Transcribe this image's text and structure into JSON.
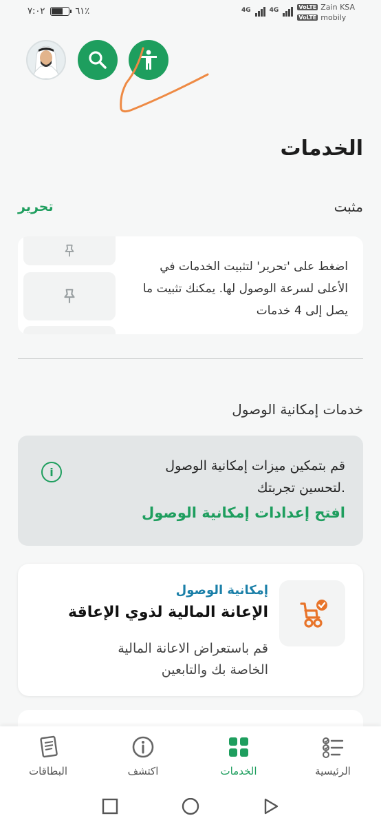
{
  "status_bar": {
    "time": "٧:٠٢",
    "battery": "٦١٪",
    "signal_1": "4G",
    "signal_2": "4G",
    "carrier_1": "Zain KSA",
    "carrier_2": "mobily",
    "volte": "VoLTE"
  },
  "header": {
    "search_icon": "search-icon",
    "accessibility_icon": "accessibility-icon",
    "accent_color": "#1e9e5e"
  },
  "page": {
    "title": "الخدمات"
  },
  "pinned": {
    "label": "مثبت",
    "edit": "تحرير",
    "hint": "اضغط على 'تحرير' لتثبيت الخدمات في الأعلى لسرعة الوصول لها. يمكنك تثبيت ما يصل إلى 4 خدمات"
  },
  "accessibility": {
    "section_title": "خدمات إمكانية الوصول",
    "info_line1": "قم بتمكين ميزات إمكانية الوصول",
    "info_line2": "لتحسين تجربتك.",
    "info_link": "افتح إعدادات إمكانية الوصول"
  },
  "service_card": {
    "category": "إمكانية الوصول",
    "title": "الإعانة المالية لذوي الإعاقة",
    "desc_line1": "قم باستعراض الاعانة المالية",
    "desc_line2": "الخاصة بك والتابعين",
    "icon_color": "#e8742a"
  },
  "bottom_nav": {
    "home": "الرئيسية",
    "services": "الخدمات",
    "discover": "اكتشف",
    "cards": "البطاقات",
    "active": "services"
  }
}
